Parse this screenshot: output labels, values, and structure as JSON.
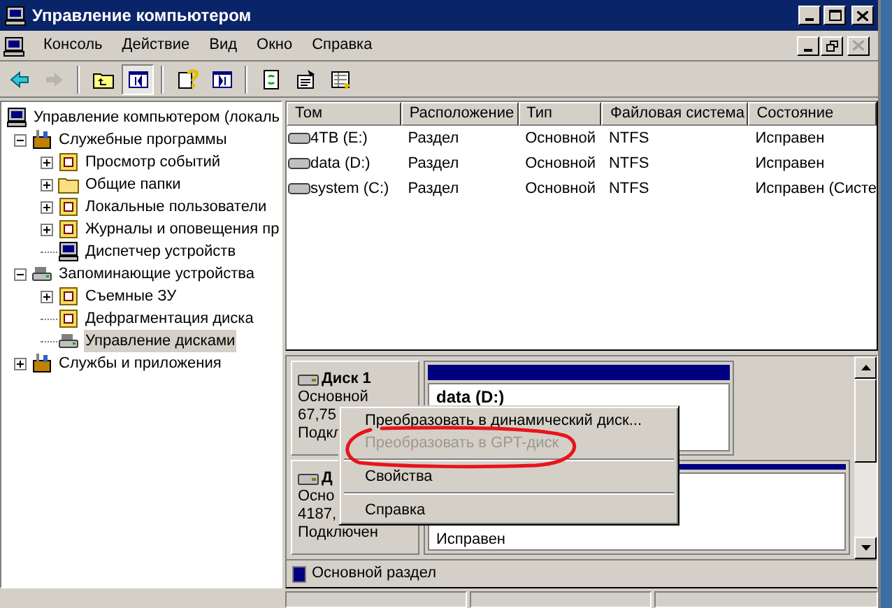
{
  "window": {
    "title": "Управление компьютером"
  },
  "menu": [
    {
      "label": "Консоль"
    },
    {
      "label": "Действие"
    },
    {
      "label": "Вид"
    },
    {
      "label": "Окно"
    },
    {
      "label": "Справка"
    }
  ],
  "toolbar": [
    {
      "kind": "back",
      "disabled": false,
      "pressed": false
    },
    {
      "kind": "forward",
      "disabled": true,
      "pressed": false
    },
    {
      "kind": "sep"
    },
    {
      "kind": "up",
      "disabled": false,
      "pressed": false
    },
    {
      "kind": "tree",
      "disabled": false,
      "pressed": true
    },
    {
      "kind": "sep"
    },
    {
      "kind": "help",
      "disabled": false,
      "pressed": false
    },
    {
      "kind": "panel",
      "disabled": false,
      "pressed": false
    },
    {
      "kind": "sep"
    },
    {
      "kind": "refresh",
      "disabled": false,
      "pressed": false
    },
    {
      "kind": "props",
      "disabled": false,
      "pressed": false
    },
    {
      "kind": "export",
      "disabled": false,
      "pressed": false
    }
  ],
  "tree": [
    {
      "label": "Управление компьютером (локаль",
      "kind": "computer",
      "selected": false,
      "children": [
        {
          "label": "Служебные программы",
          "kind": "tools",
          "expanded": true,
          "selected": false,
          "children": [
            {
              "label": "Просмотр событий",
              "kind": "item",
              "expanded": false,
              "selected": false
            },
            {
              "label": "Общие папки",
              "kind": "folder",
              "expanded": false,
              "selected": false
            },
            {
              "label": "Локальные пользователи",
              "kind": "item",
              "expanded": false,
              "selected": false
            },
            {
              "label": "Журналы и оповещения пр",
              "kind": "item",
              "expanded": false,
              "selected": false
            },
            {
              "label": "Диспетчер устройств",
              "kind": "computer",
              "selected": false
            }
          ]
        },
        {
          "label": "Запоминающие устройства",
          "kind": "drive",
          "expanded": true,
          "selected": false,
          "children": [
            {
              "label": "Съемные ЗУ",
              "kind": "item",
              "expanded": false,
              "selected": false
            },
            {
              "label": "Дефрагментация диска",
              "kind": "item",
              "selected": false
            },
            {
              "label": "Управление дисками",
              "kind": "drive",
              "selected": true
            }
          ]
        },
        {
          "label": "Службы и приложения",
          "kind": "tools",
          "expanded": false,
          "selected": false
        }
      ]
    }
  ],
  "table": {
    "columns": [
      "Том",
      "Расположение",
      "Тип",
      "Файловая система",
      "Состояние"
    ],
    "rows": [
      [
        "4TB (E:)",
        "Раздел",
        "Основной",
        "NTFS",
        "Исправен"
      ],
      [
        "data (D:)",
        "Раздел",
        "Основной",
        "NTFS",
        "Исправен"
      ],
      [
        "system (C:)",
        "Раздел",
        "Основной",
        "NTFS",
        "Исправен (Систе"
      ]
    ]
  },
  "disks": [
    {
      "name": "Диск 1",
      "lines": [
        "Основной",
        "67,75",
        "Подкл"
      ],
      "partition": {
        "name": "data (D:)"
      }
    },
    {
      "name": "Д",
      "lines": [
        "Осно",
        "4187,",
        "Подключен"
      ],
      "partition": {
        "lines": [
          "Исправен"
        ]
      }
    }
  ],
  "legend": [
    {
      "label": "Основной раздел",
      "color": "#000080"
    }
  ],
  "context_menu": [
    {
      "kind": "item",
      "label": "Преобразовать в динамический диск...",
      "disabled": false
    },
    {
      "kind": "item",
      "label": "Преобразовать в GPT-диск",
      "disabled": true
    },
    {
      "kind": "separator"
    },
    {
      "kind": "item",
      "label": "Свойства",
      "disabled": false
    },
    {
      "kind": "separator"
    },
    {
      "kind": "item",
      "label": "Справка",
      "disabled": false
    }
  ]
}
